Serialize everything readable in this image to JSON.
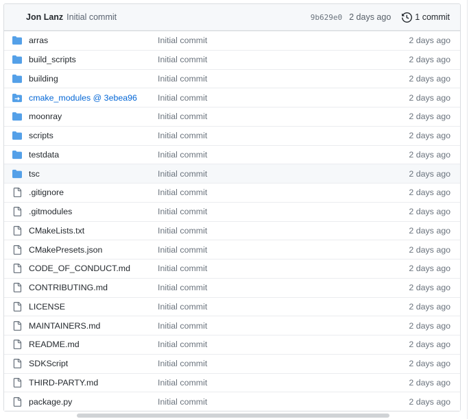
{
  "commit_header": {
    "author": "Jon Lanz",
    "message": "Initial commit",
    "hash": "9b629e0",
    "age": "2 days ago",
    "commit_count": "1 commit"
  },
  "file_table": {
    "rows": [
      {
        "name": "arras",
        "type": "folder",
        "message": "Initial commit",
        "age": "2 days ago"
      },
      {
        "name": "build_scripts",
        "type": "folder",
        "message": "Initial commit",
        "age": "2 days ago"
      },
      {
        "name": "building",
        "type": "folder",
        "message": "Initial commit",
        "age": "2 days ago"
      },
      {
        "name": "cmake_modules @ 3ebea96",
        "type": "submodule",
        "message": "Initial commit",
        "age": "2 days ago"
      },
      {
        "name": "moonray",
        "type": "folder",
        "message": "Initial commit",
        "age": "2 days ago"
      },
      {
        "name": "scripts",
        "type": "folder",
        "message": "Initial commit",
        "age": "2 days ago"
      },
      {
        "name": "testdata",
        "type": "folder",
        "message": "Initial commit",
        "age": "2 days ago"
      },
      {
        "name": "tsc",
        "type": "folder",
        "message": "Initial commit",
        "age": "2 days ago",
        "highlighted": true
      },
      {
        "name": ".gitignore",
        "type": "file",
        "message": "Initial commit",
        "age": "2 days ago"
      },
      {
        "name": ".gitmodules",
        "type": "file",
        "message": "Initial commit",
        "age": "2 days ago"
      },
      {
        "name": "CMakeLists.txt",
        "type": "file",
        "message": "Initial commit",
        "age": "2 days ago"
      },
      {
        "name": "CMakePresets.json",
        "type": "file",
        "message": "Initial commit",
        "age": "2 days ago"
      },
      {
        "name": "CODE_OF_CONDUCT.md",
        "type": "file",
        "message": "Initial commit",
        "age": "2 days ago"
      },
      {
        "name": "CONTRIBUTING.md",
        "type": "file",
        "message": "Initial commit",
        "age": "2 days ago"
      },
      {
        "name": "LICENSE",
        "type": "file",
        "message": "Initial commit",
        "age": "2 days ago"
      },
      {
        "name": "MAINTAINERS.md",
        "type": "file",
        "message": "Initial commit",
        "age": "2 days ago"
      },
      {
        "name": "README.md",
        "type": "file",
        "message": "Initial commit",
        "age": "2 days ago"
      },
      {
        "name": "SDKScript",
        "type": "file",
        "message": "Initial commit",
        "age": "2 days ago"
      },
      {
        "name": "THIRD-PARTY.md",
        "type": "file",
        "message": "Initial commit",
        "age": "2 days ago"
      },
      {
        "name": "package.py",
        "type": "file",
        "message": "Initial commit",
        "age": "2 days ago"
      }
    ]
  },
  "colors": {
    "folder_icon": "#54a0e8",
    "submodule_icon": "#54a0e8",
    "file_icon": "#6e7781",
    "history_icon": "#24292e",
    "link_blue": "#0366d6",
    "header_bg": "#f6f8fa",
    "border": "#d9dce0",
    "row_border": "#eaecef"
  }
}
